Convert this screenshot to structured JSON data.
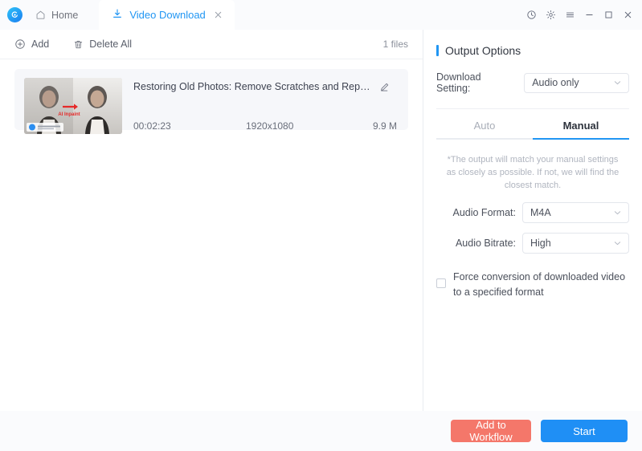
{
  "titlebar": {
    "logo_icon": "app-logo-icon",
    "home_label": "Home",
    "home_icon": "home-icon",
    "tab": {
      "label": "Video Download",
      "icon": "download-icon",
      "close_icon": "close-icon"
    },
    "controls": {
      "history_icon": "clock-history-icon",
      "settings_icon": "gear-icon",
      "menu_icon": "hamburger-menu-icon",
      "minimize_icon": "minimize-icon",
      "maximize_icon": "maximize-icon",
      "close_icon": "window-close-icon"
    }
  },
  "left": {
    "toolbar": {
      "add_label": "Add",
      "add_icon": "plus-circle-icon",
      "delete_all_label": "Delete All",
      "delete_all_icon": "trash-icon",
      "files_count": "1 files"
    },
    "files": [
      {
        "title": "Restoring Old Photos: Remove Scratches and Repair Dama...",
        "edit_icon": "pencil-edit-icon",
        "duration": "00:02:23",
        "resolution": "1920x1080",
        "size": "9.9 M",
        "thumbnail_caption": "AI Inpaint"
      }
    ]
  },
  "right": {
    "panel_title": "Output Options",
    "download_setting": {
      "label": "Download Setting:",
      "value": "Audio only",
      "chevron_icon": "chevron-down-icon"
    },
    "mode_tabs": [
      {
        "label": "Auto",
        "active": false
      },
      {
        "label": "Manual",
        "active": true
      }
    ],
    "note": "*The output will match your manual settings as closely as possible. If not, we will find the closest match.",
    "fields": [
      {
        "label": "Audio Format:",
        "value": "M4A",
        "chevron_icon": "chevron-down-icon"
      },
      {
        "label": "Audio Bitrate:",
        "value": "High",
        "chevron_icon": "chevron-down-icon"
      }
    ],
    "force_conversion": {
      "label": "Force conversion of downloaded video to a specified format",
      "checked": false
    }
  },
  "footer": {
    "add_to_workflow_label": "Add to Workflow",
    "start_label": "Start"
  },
  "colors": {
    "accent_blue": "#2196f3",
    "start_blue": "#1f8ff5",
    "workflow_coral": "#f4776a",
    "card_bg": "#f6f7fa",
    "titlebar_bg": "#fafbfd"
  }
}
